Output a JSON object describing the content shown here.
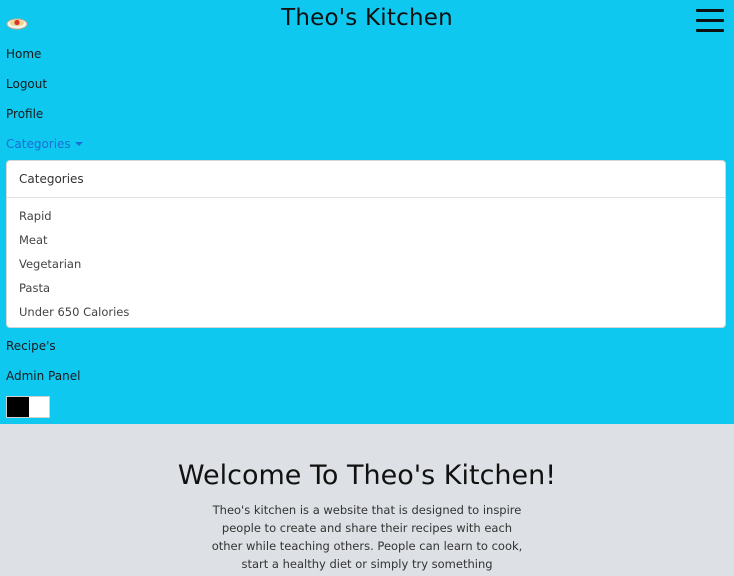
{
  "navbar": {
    "brand": "Theo's Kitchen",
    "links": {
      "home": "Home",
      "logout": "Logout",
      "profile": "Profile",
      "categories": "Categories",
      "recipes": "Recipe's",
      "admin": "Admin Panel"
    },
    "dropdown": {
      "header": "Categories",
      "items": [
        "Rapid",
        "Meat",
        "Vegetarian",
        "Pasta",
        "Under 650 Calories"
      ]
    },
    "colors": {
      "background": "#0fc8f0",
      "active_link": "#1a6fd6"
    }
  },
  "main": {
    "title": "Welcome To Theo's Kitchen!",
    "paragraph": "Theo's kitchen is a website that is designed to inspire people to create and share their recipes with each other while teaching others. People can learn to cook, start a healthy diet or simply try something"
  }
}
